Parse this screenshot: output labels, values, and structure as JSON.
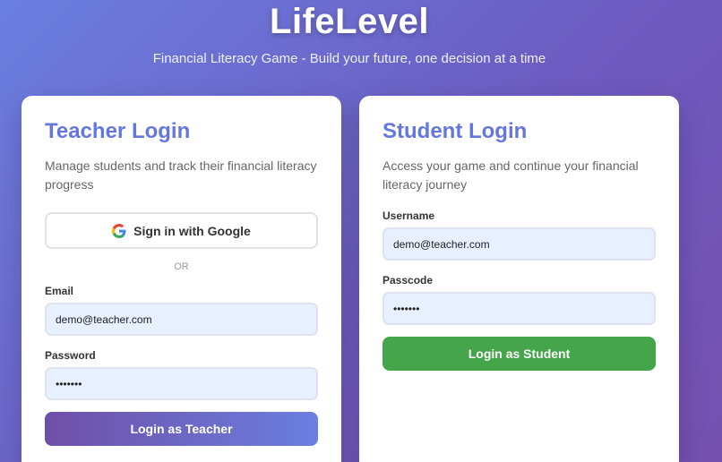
{
  "header": {
    "title": "LifeLevel",
    "subtitle": "Financial Literacy Game - Build your future, one decision at a time"
  },
  "teacher": {
    "title": "Teacher Login",
    "description": "Manage students and track their financial literacy progress",
    "google_label": "Sign in with Google",
    "divider": "OR",
    "email_label": "Email",
    "email_value": "demo@teacher.com",
    "password_label": "Password",
    "password_value": "•••••••",
    "login_label": "Login as Teacher"
  },
  "student": {
    "title": "Student Login",
    "description": "Access your game and continue your financial literacy journey",
    "username_label": "Username",
    "username_value": "demo@teacher.com",
    "passcode_label": "Passcode",
    "passcode_value": "•••••••",
    "login_label": "Login as Student"
  },
  "colors": {
    "accent": "#6477dc",
    "teacher_button": "#6f4fa8",
    "student_button": "#45a54b",
    "input_bg": "#e8efff"
  },
  "icons": {
    "google": "google-icon"
  }
}
